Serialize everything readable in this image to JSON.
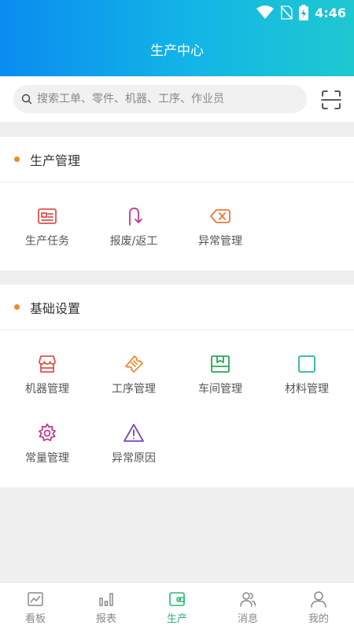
{
  "status_bar": {
    "time": "4:46"
  },
  "header": {
    "title": "生产中心"
  },
  "search": {
    "placeholder": "搜索工单、零件、机器、工序、作业员"
  },
  "sections": [
    {
      "title": "生产管理",
      "items": [
        {
          "label": "生产任务",
          "icon": "id-card-icon",
          "color": "#e0524c"
        },
        {
          "label": "报废/返工",
          "icon": "u-turn-arrow-icon",
          "color": "#c2388f"
        },
        {
          "label": "异常管理",
          "icon": "tag-close-icon",
          "color": "#ee7a35"
        }
      ]
    },
    {
      "title": "基础设置",
      "items": [
        {
          "label": "机器管理",
          "icon": "store-icon",
          "color": "#e0524c"
        },
        {
          "label": "工序管理",
          "icon": "ticket-icon",
          "color": "#ee8a35"
        },
        {
          "label": "车间管理",
          "icon": "box-icon",
          "color": "#2aa45a"
        },
        {
          "label": "材料管理",
          "icon": "square-icon",
          "color": "#25b3a8"
        },
        {
          "label": "常量管理",
          "icon": "gear-icon",
          "color": "#c2388f"
        },
        {
          "label": "异常原因",
          "icon": "warning-icon",
          "color": "#7b47b3"
        }
      ]
    }
  ],
  "tabbar": {
    "tabs": [
      {
        "label": "看板",
        "icon": "dashboard-icon"
      },
      {
        "label": "报表",
        "icon": "bar-chart-icon"
      },
      {
        "label": "生产",
        "icon": "wallet-icon",
        "active": true
      },
      {
        "label": "消息",
        "icon": "users-icon"
      },
      {
        "label": "我的",
        "icon": "person-icon"
      }
    ]
  },
  "colors": {
    "accent": "#2ab77a",
    "dot": "#f08a24",
    "header_start": "#0a8cf0",
    "header_end": "#1ec8d0"
  }
}
